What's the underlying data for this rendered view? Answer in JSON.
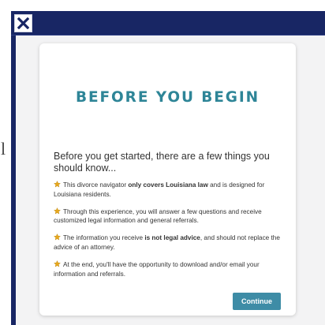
{
  "background": {
    "fragment_text": "l"
  },
  "modal": {
    "header_color": "#182664",
    "close_icon": "close-icon"
  },
  "card": {
    "title": "BEFORE YOU BEGIN",
    "intro": "Before you get started, there are a few things you should know...",
    "bullets": [
      {
        "icon": "star-icon",
        "pre": "This divorce navigator ",
        "bold": "only covers Louisiana law",
        "post": " and is designed for Louisiana residents."
      },
      {
        "icon": "star-icon",
        "pre": "Through this experience, you will answer a few questions and receive customized legal information and general referrals.",
        "bold": "",
        "post": ""
      },
      {
        "icon": "star-icon",
        "pre": "The information you receive ",
        "bold": "is not legal advice",
        "post": ", and should not replace the advice of an attorney."
      },
      {
        "icon": "star-icon",
        "pre": "At the end, you'll have the opportunity to download and/or email your information and referrals.",
        "bold": "",
        "post": ""
      }
    ],
    "continue_label": "Continue"
  },
  "colors": {
    "title": "#2e8597",
    "button": "#3e8ca6",
    "star": "#e8a81b"
  }
}
